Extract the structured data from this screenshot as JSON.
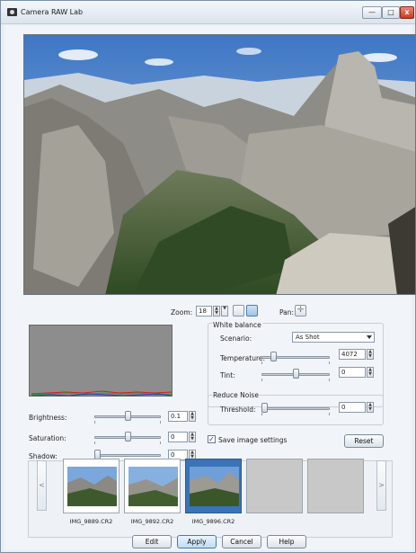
{
  "window": {
    "title": "Camera RAW Lab",
    "min_glyph": "—",
    "max_glyph": "□",
    "close_glyph": "x"
  },
  "view": {
    "zoom_label": "Zoom:",
    "zoom_value": "18",
    "pan_label": "Pan:"
  },
  "adjust": {
    "brightness_label": "Brightness:",
    "brightness_value": "0.1",
    "brightness_level": 0.5,
    "saturation_label": "Saturation:",
    "saturation_value": "0",
    "saturation_level": 0.5,
    "shadow_label": "Shadow:",
    "shadow_value": "0",
    "shadow_level": 0.0
  },
  "white_balance": {
    "group_label": "White balance",
    "scenario_label": "Scenario:",
    "scenario_value": "As Shot",
    "temperature_label": "Temperature:",
    "temperature_value": "4072",
    "temperature_level": 0.15,
    "tint_label": "Tint:",
    "tint_value": "0",
    "tint_level": 0.5
  },
  "noise": {
    "group_label": "Reduce Noise",
    "threshold_label": "Threshold:",
    "threshold_value": "0",
    "threshold_level": 0.0
  },
  "settings": {
    "save_label": "Save image settings",
    "save_checked": true,
    "reset_label": "Reset"
  },
  "filmstrip": {
    "prev_glyph": "<",
    "next_glyph": ">",
    "items": [
      {
        "filename": "IMG_9889.CR2",
        "selected": false
      },
      {
        "filename": "IMG_9892.CR2",
        "selected": false
      },
      {
        "filename": "IMG_9896.CR2",
        "selected": true
      }
    ]
  },
  "actions": {
    "edit": "Edit",
    "apply": "Apply",
    "cancel": "Cancel",
    "help": "Help"
  },
  "colors": {
    "accent": "#3a73b6",
    "sky": "#5c8fcf",
    "rock": "#9a9a95",
    "forest": "#3f5a2e"
  }
}
